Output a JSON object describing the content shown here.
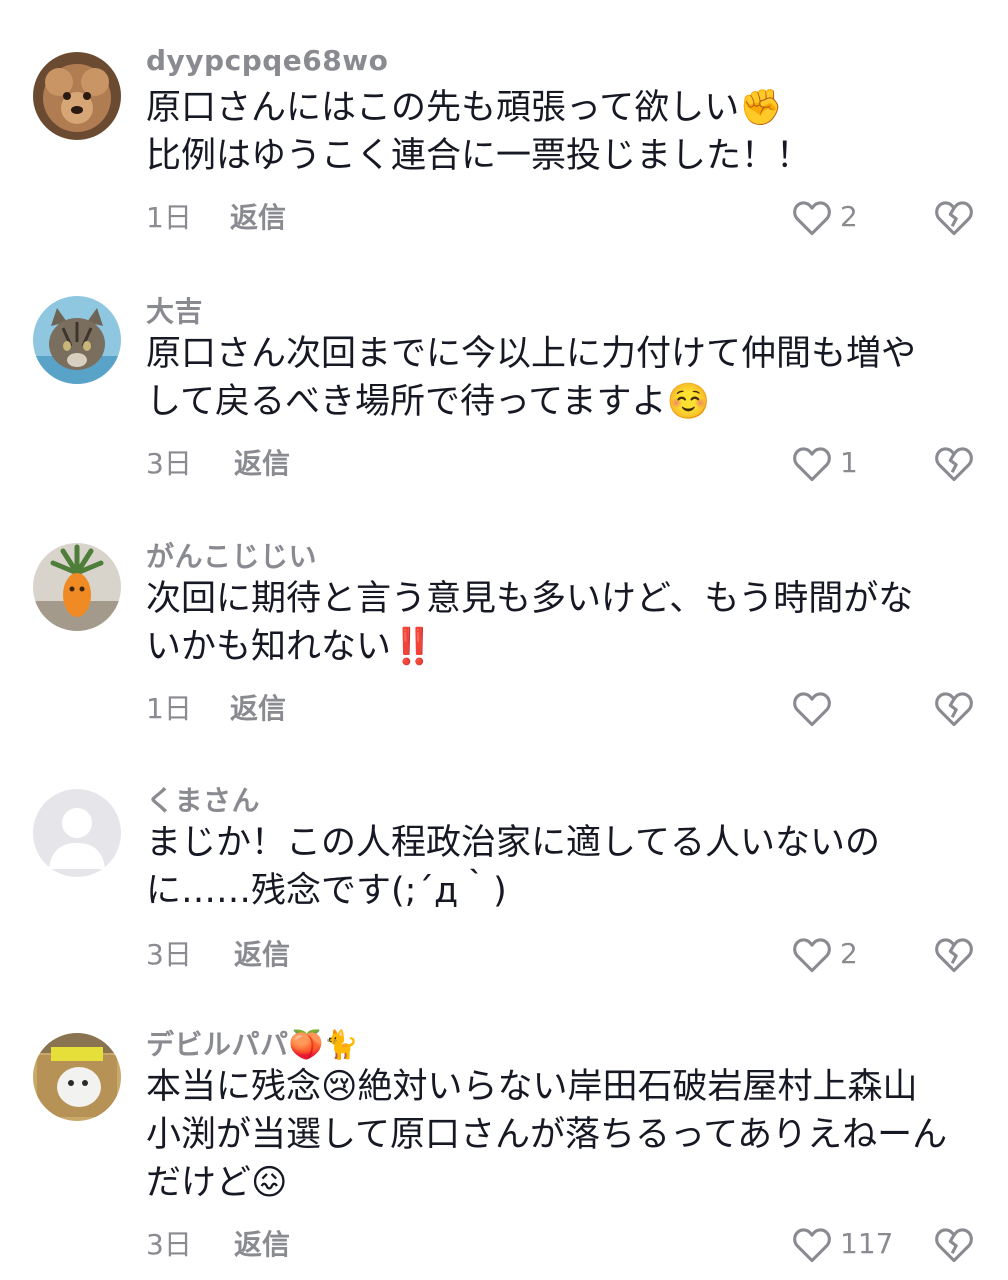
{
  "comments": [
    {
      "username": "dyypcpqe68wo",
      "lines": [
        "原口さんにはこの先も頑張って欲しい✊",
        "比例はゆうこく連合に一票投じました！！"
      ],
      "time": "1日",
      "reply_label": "返信",
      "likes": "2",
      "avatar": "dog-avatar"
    },
    {
      "username": "大吉",
      "lines": [
        "原口さん次回までに今以上に力付けて仲間も増や",
        "して戻るべき場所で待ってますよ☺️"
      ],
      "time": "3日",
      "reply_label": "返信",
      "likes": "1",
      "avatar": "cat-avatar"
    },
    {
      "username": "がんこじじい",
      "lines": [
        "次回に期待と言う意見も多いけど、もう時間がな",
        "いかも知れない‼️"
      ],
      "time": "1日",
      "reply_label": "返信",
      "likes": "",
      "avatar": "carrot-avatar"
    },
    {
      "username": "くまさん",
      "lines": [
        "まじか！この人程政治家に適してる人いないの",
        "に……残念です(;´д｀)"
      ],
      "time": "3日",
      "reply_label": "返信",
      "likes": "2",
      "avatar": "default-avatar"
    },
    {
      "username": "デビルパパ🍑🐈",
      "lines": [
        "本当に残念😢絶対いらない岸田石破岩屋村上森山",
        "小渕が当選して原口さんが落ちるってありえねーん",
        "だけど😖"
      ],
      "time": "3日",
      "reply_label": "返信",
      "likes": "117",
      "avatar": "kitten-box-avatar"
    }
  ]
}
